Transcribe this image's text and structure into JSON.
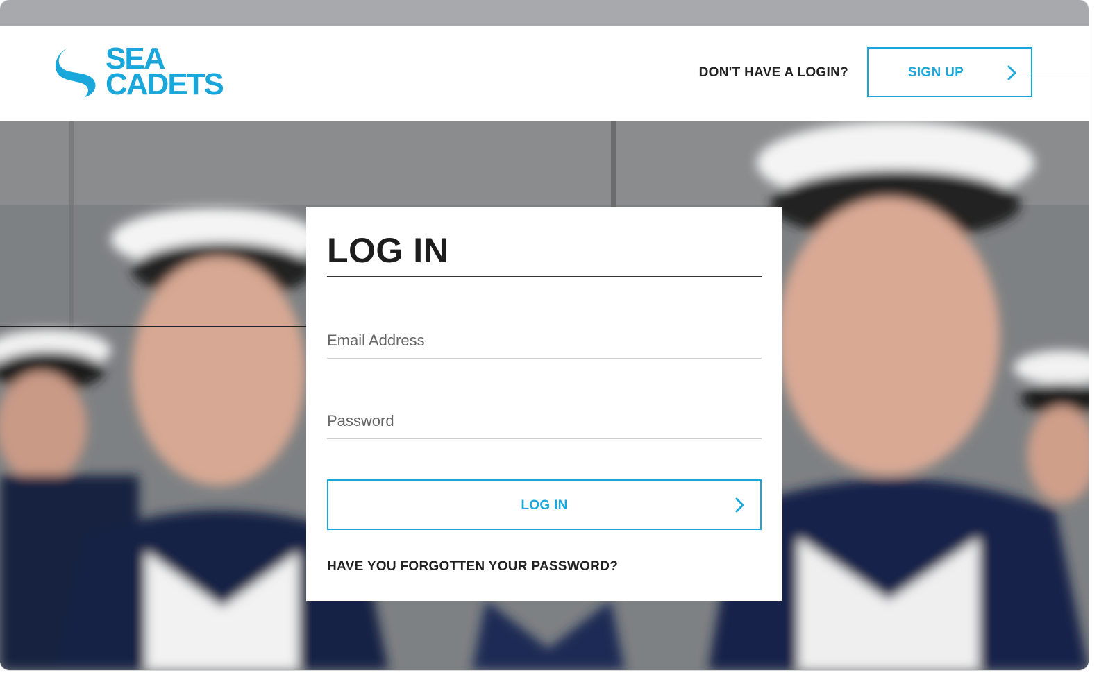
{
  "brand": {
    "logo_line1": "SEA",
    "logo_line2": "CADETS",
    "accent_color": "#1aa7dc",
    "logo_icon": "wave-s-logo-icon"
  },
  "header": {
    "signup_prompt": "DON'T HAVE A LOGIN?",
    "signup_label": "SIGN UP",
    "signup_icon": "chevron-right-icon"
  },
  "login_card": {
    "title": "LOG IN",
    "email_placeholder": "Email Address",
    "email_value": "",
    "password_placeholder": "Password",
    "password_value": "",
    "submit_label": "LOG IN",
    "submit_icon": "chevron-right-icon",
    "forgot_label": "HAVE YOU FORGOTTEN YOUR PASSWORD?"
  }
}
